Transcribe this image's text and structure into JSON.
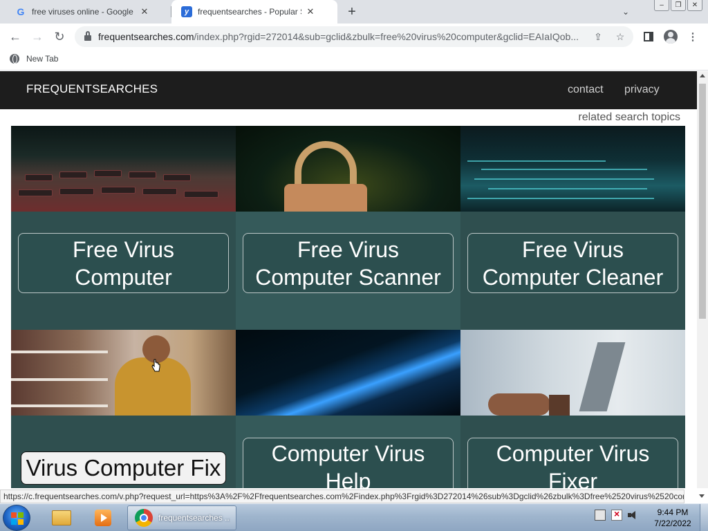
{
  "browser": {
    "tabs": [
      {
        "title": "free viruses online - Google Sear",
        "favicon": "google-icon"
      },
      {
        "title": "frequentsearches - Popular Searc",
        "favicon": "site-icon",
        "active": true
      }
    ],
    "url_host": "frequentsearches.com",
    "url_path": "/index.php?rgid=272014&sub=gclid&zbulk=free%20virus%20computer&gclid=EAIaIQob...",
    "bookmark": "New Tab"
  },
  "site": {
    "brand": "FREQUENTSEARCHES",
    "nav": [
      "contact",
      "privacy"
    ],
    "related": "related search topics",
    "cards": [
      {
        "label": "Free Virus Computer",
        "image": "keyboard-image"
      },
      {
        "label": "Free Virus Computer Scanner",
        "image": "padlock-image"
      },
      {
        "label": "Free Virus Computer Cleaner",
        "image": "circuit-image"
      },
      {
        "label": "Virus Computer Fix",
        "image": "shopper-image"
      },
      {
        "label": "Computer Virus Help",
        "image": "light-streak-image"
      },
      {
        "label": "Computer Virus Fixer",
        "image": "laptop-image"
      }
    ]
  },
  "statusbar": {
    "link": "https://c.frequentsearches.com/v.php?request_url=https%3A%2F%2Ffrequentsearches.com%2Findex.php%3Frgid%3D272014%26sub%3Dgclid%26zbulk%3Dfree%2520virus%2520com..."
  },
  "taskbar": {
    "chrome_label": "frequentsearches ...",
    "time": "9:44 PM",
    "date": "7/22/2022"
  }
}
